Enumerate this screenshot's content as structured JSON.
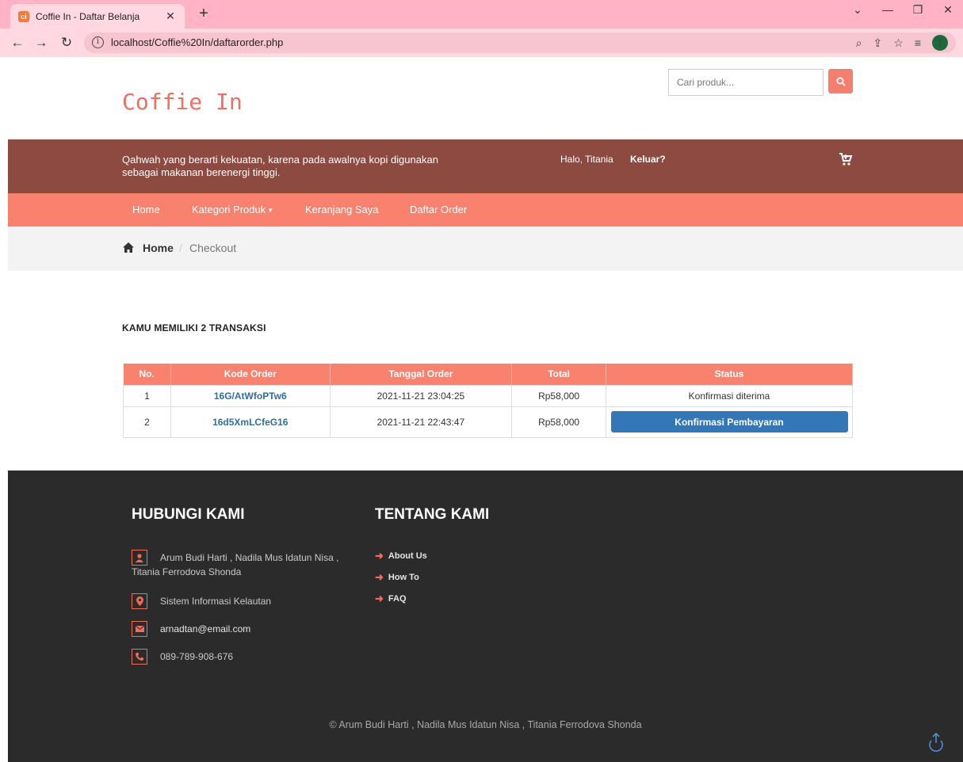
{
  "browser": {
    "tab_title": "Coffie In - Daftar Belanja",
    "url": "localhost/Coffie%20In/daftarorder.php",
    "avatar_letter": "T",
    "favicon_text": "ci"
  },
  "header": {
    "logo": "Coffie In",
    "search_placeholder": "Cari produk..."
  },
  "topbar": {
    "tagline": "Qahwah yang berarti kekuatan, karena pada awalnya kopi digunakan sebagai makanan berenergi tinggi.",
    "greeting": "Halo, Titania",
    "logout": "Keluar?"
  },
  "nav": {
    "home": "Home",
    "kategori": "Kategori Produk",
    "keranjang": "Keranjang Saya",
    "daftar_order": "Daftar Order"
  },
  "breadcrumb": {
    "home": "Home",
    "separator": "/",
    "current": "Checkout"
  },
  "orders": {
    "heading": "KAMU MEMILIKI 2 TRANSAKSI",
    "columns": [
      "No.",
      "Kode Order",
      "Tanggal Order",
      "Total",
      "Status"
    ],
    "rows": [
      {
        "no": "1",
        "code": "16G/AtWfoPTw6",
        "date": "2021-11-21 23:04:25",
        "total": "Rp58,000",
        "status": "Konfirmasi diterima"
      },
      {
        "no": "2",
        "code": "16d5XmLCfeG16",
        "date": "2021-11-21 22:43:47",
        "total": "Rp58,000",
        "status": "Konfirmasi Pembayaran"
      }
    ]
  },
  "footer": {
    "contact_title": "HUBUNGI KAMI",
    "about_title": "TENTANG KAMI",
    "authors": "Arum Budi Harti , Nadila Mus Idatun Nisa , Titania Ferrodova Shonda",
    "org": "Sistem Informasi Kelautan",
    "email": "arnadtan@email.com",
    "phone": "089-789-908-676",
    "links": [
      "About Us",
      "How To",
      "FAQ"
    ],
    "copyright": "© Arum Budi Harti , Nadila Mus Idatun Nisa , Titania Ferrodova Shonda"
  },
  "colors": {
    "brand_brown": "#8d4a41",
    "nav_salmon": "#f9826f",
    "primary_blue": "#3377b8",
    "footer_dark": "#2b2b2b"
  }
}
